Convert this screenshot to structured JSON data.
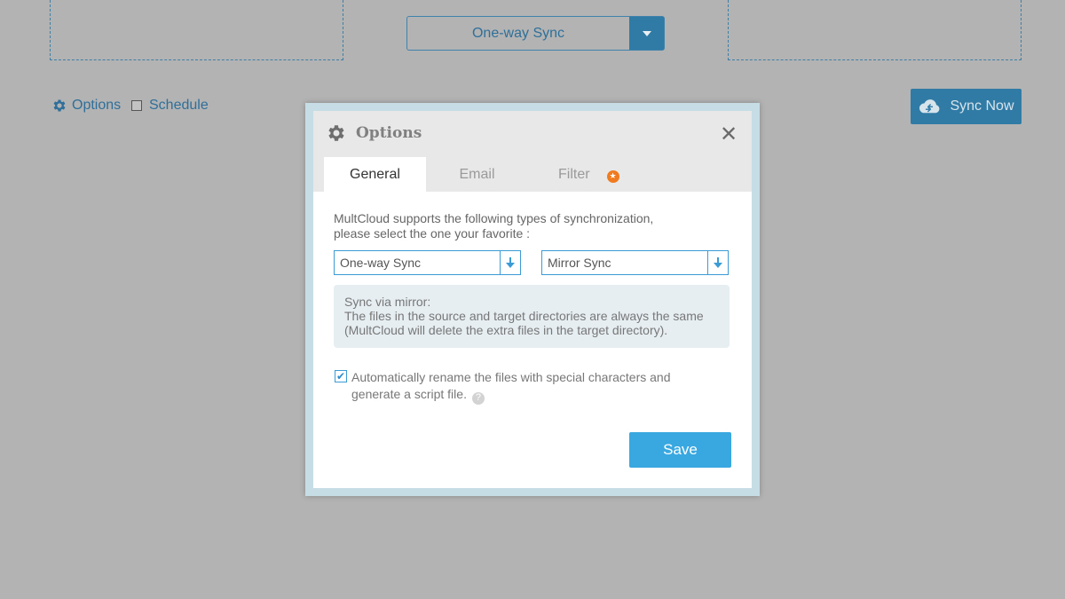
{
  "background": {
    "sync_mode_select": {
      "value": "One-way Sync"
    },
    "options_link": "Options",
    "schedule_label": "Schedule",
    "sync_now_button": "Sync Now"
  },
  "dialog": {
    "title": "Options",
    "close_icon": "close-icon",
    "tabs": [
      {
        "label": "General",
        "active": true
      },
      {
        "label": "Email",
        "active": false
      },
      {
        "label": "Filter",
        "active": false,
        "badge": "star-icon"
      }
    ],
    "general": {
      "intro_line1": "MultCloud supports the following types of synchronization,",
      "intro_line2": "please select the one your favorite :",
      "sync_type_select": "One-way Sync",
      "sync_method_select": "Mirror Sync",
      "info_title": "Sync via mirror:",
      "info_line1": "The files in the source and target directories are always the same",
      "info_line2": "(MultCloud will delete the extra files in the target directory).",
      "rename_checked": true,
      "rename_line1": "Automatically rename the files with special characters and",
      "rename_line2": "generate a script file."
    },
    "save_button": "Save"
  },
  "colors": {
    "accent": "#3aa8e0",
    "bg_accent": "#2f7ba6",
    "overlay": "#b3b3b3",
    "badge": "#f07b1e"
  }
}
